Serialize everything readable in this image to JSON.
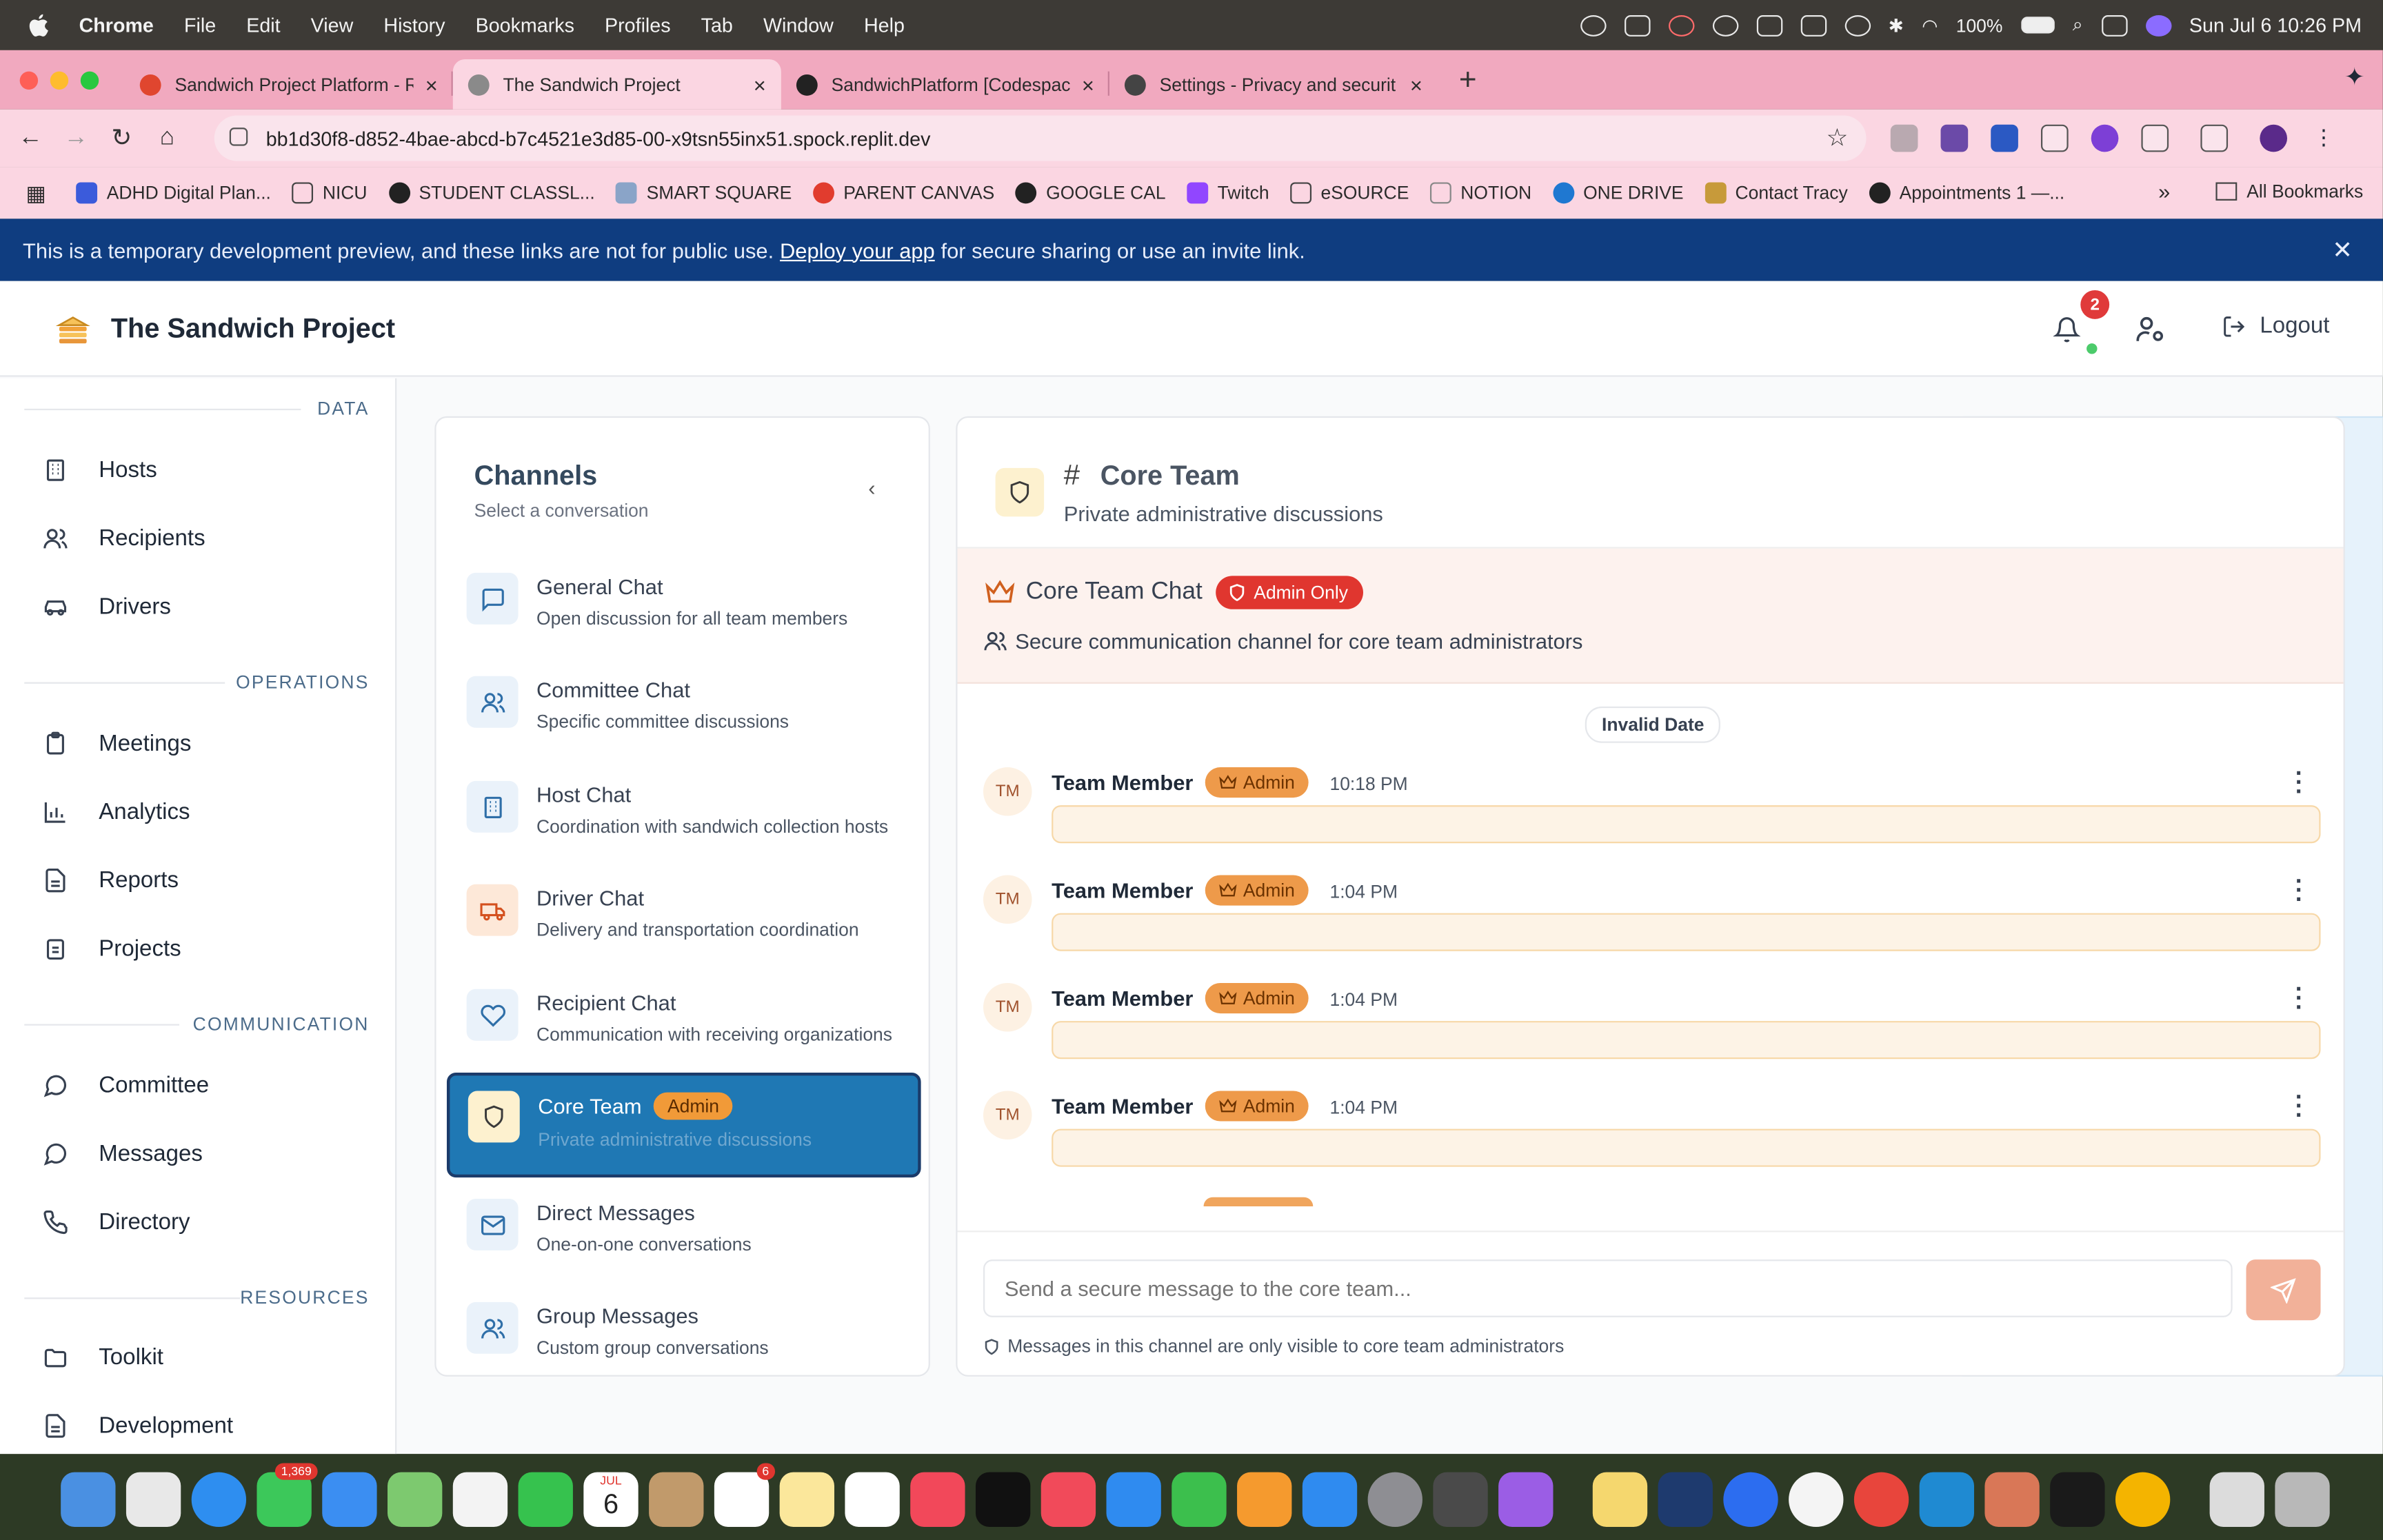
{
  "menubar": {
    "app": "Chrome",
    "items": [
      "File",
      "Edit",
      "View",
      "History",
      "Bookmarks",
      "Profiles",
      "Tab",
      "Window",
      "Help"
    ],
    "battery": "100%",
    "clock": "Sun Jul 6  10:26 PM"
  },
  "browser": {
    "tabs": [
      {
        "title": "Sandwich Project Platform - R",
        "color": "#e0462f"
      },
      {
        "title": "The Sandwich Project",
        "color": "#8a8a8a"
      },
      {
        "title": "SandwichPlatform [Codespac",
        "color": "#222222"
      },
      {
        "title": "Settings - Privacy and securit",
        "color": "#444444"
      }
    ],
    "url": "bb1d30f8-d852-4bae-abcd-b7c4521e3d85-00-x9tsn55inx51.spock.replit.dev",
    "bookmarks": [
      "ADHD Digital Plan...",
      "NICU",
      "STUDENT CLASSL...",
      "SMART SQUARE",
      "PARENT CANVAS",
      "GOOGLE CAL",
      "Twitch",
      "eSOURCE",
      "NOTION",
      "ONE DRIVE",
      "Contact Tracy",
      "Appointments 1 —..."
    ],
    "all_bookmarks": "All Bookmarks"
  },
  "banner": {
    "before": "This is a temporary development preview, and these links are not for public use.",
    "link": "Deploy your app",
    "after": "for secure sharing or use an invite link."
  },
  "header": {
    "title": "The Sandwich Project",
    "notifications": "2",
    "logout": "Logout"
  },
  "sidebar": {
    "sections": {
      "data": "DATA",
      "operations": "OPERATIONS",
      "communication": "COMMUNICATION",
      "resources": "RESOURCES"
    },
    "items": [
      "Hosts",
      "Recipients",
      "Drivers",
      "Meetings",
      "Analytics",
      "Reports",
      "Projects",
      "Committee",
      "Messages",
      "Directory",
      "Toolkit",
      "Development"
    ]
  },
  "channels": {
    "title": "Channels",
    "subtitle": "Select a conversation",
    "list": [
      {
        "name": "General Chat",
        "desc": "Open discussion for all team members"
      },
      {
        "name": "Committee Chat",
        "desc": "Specific committee discussions"
      },
      {
        "name": "Host Chat",
        "desc": "Coordination with sandwich collection hosts"
      },
      {
        "name": "Driver Chat",
        "desc": "Delivery and transportation coordination"
      },
      {
        "name": "Recipient Chat",
        "desc": "Communication with receiving organizations"
      },
      {
        "name": "Core Team",
        "desc": "Private administrative discussions",
        "badge": "Admin"
      },
      {
        "name": "Direct Messages",
        "desc": "One-on-one conversations"
      },
      {
        "name": "Group Messages",
        "desc": "Custom group conversations"
      }
    ]
  },
  "chat": {
    "hash": "#",
    "title": "Core Team",
    "description": "Private administrative discussions",
    "band_title": "Core Team Chat",
    "admin_only": "Admin Only",
    "secure_text": "Secure communication channel for core team administrators",
    "date_divider": "Invalid Date",
    "messages": [
      {
        "initials": "TM",
        "author": "Team Member",
        "role": "Admin",
        "time": "10:18 PM",
        "text": ""
      },
      {
        "initials": "TM",
        "author": "Team Member",
        "role": "Admin",
        "time": "1:04 PM",
        "text": ""
      },
      {
        "initials": "TM",
        "author": "Team Member",
        "role": "Admin",
        "time": "1:04 PM",
        "text": ""
      },
      {
        "initials": "TM",
        "author": "Team Member",
        "role": "Admin",
        "time": "1:04 PM",
        "text": ""
      }
    ],
    "input_placeholder": "Send a secure message to the core team...",
    "note": "Messages in this channel are only visible to core team administrators"
  },
  "dock": {
    "badges": {
      "messages": "1,369",
      "calendar_day": "6",
      "calendar_month": "JUL",
      "reminders": "6"
    }
  }
}
